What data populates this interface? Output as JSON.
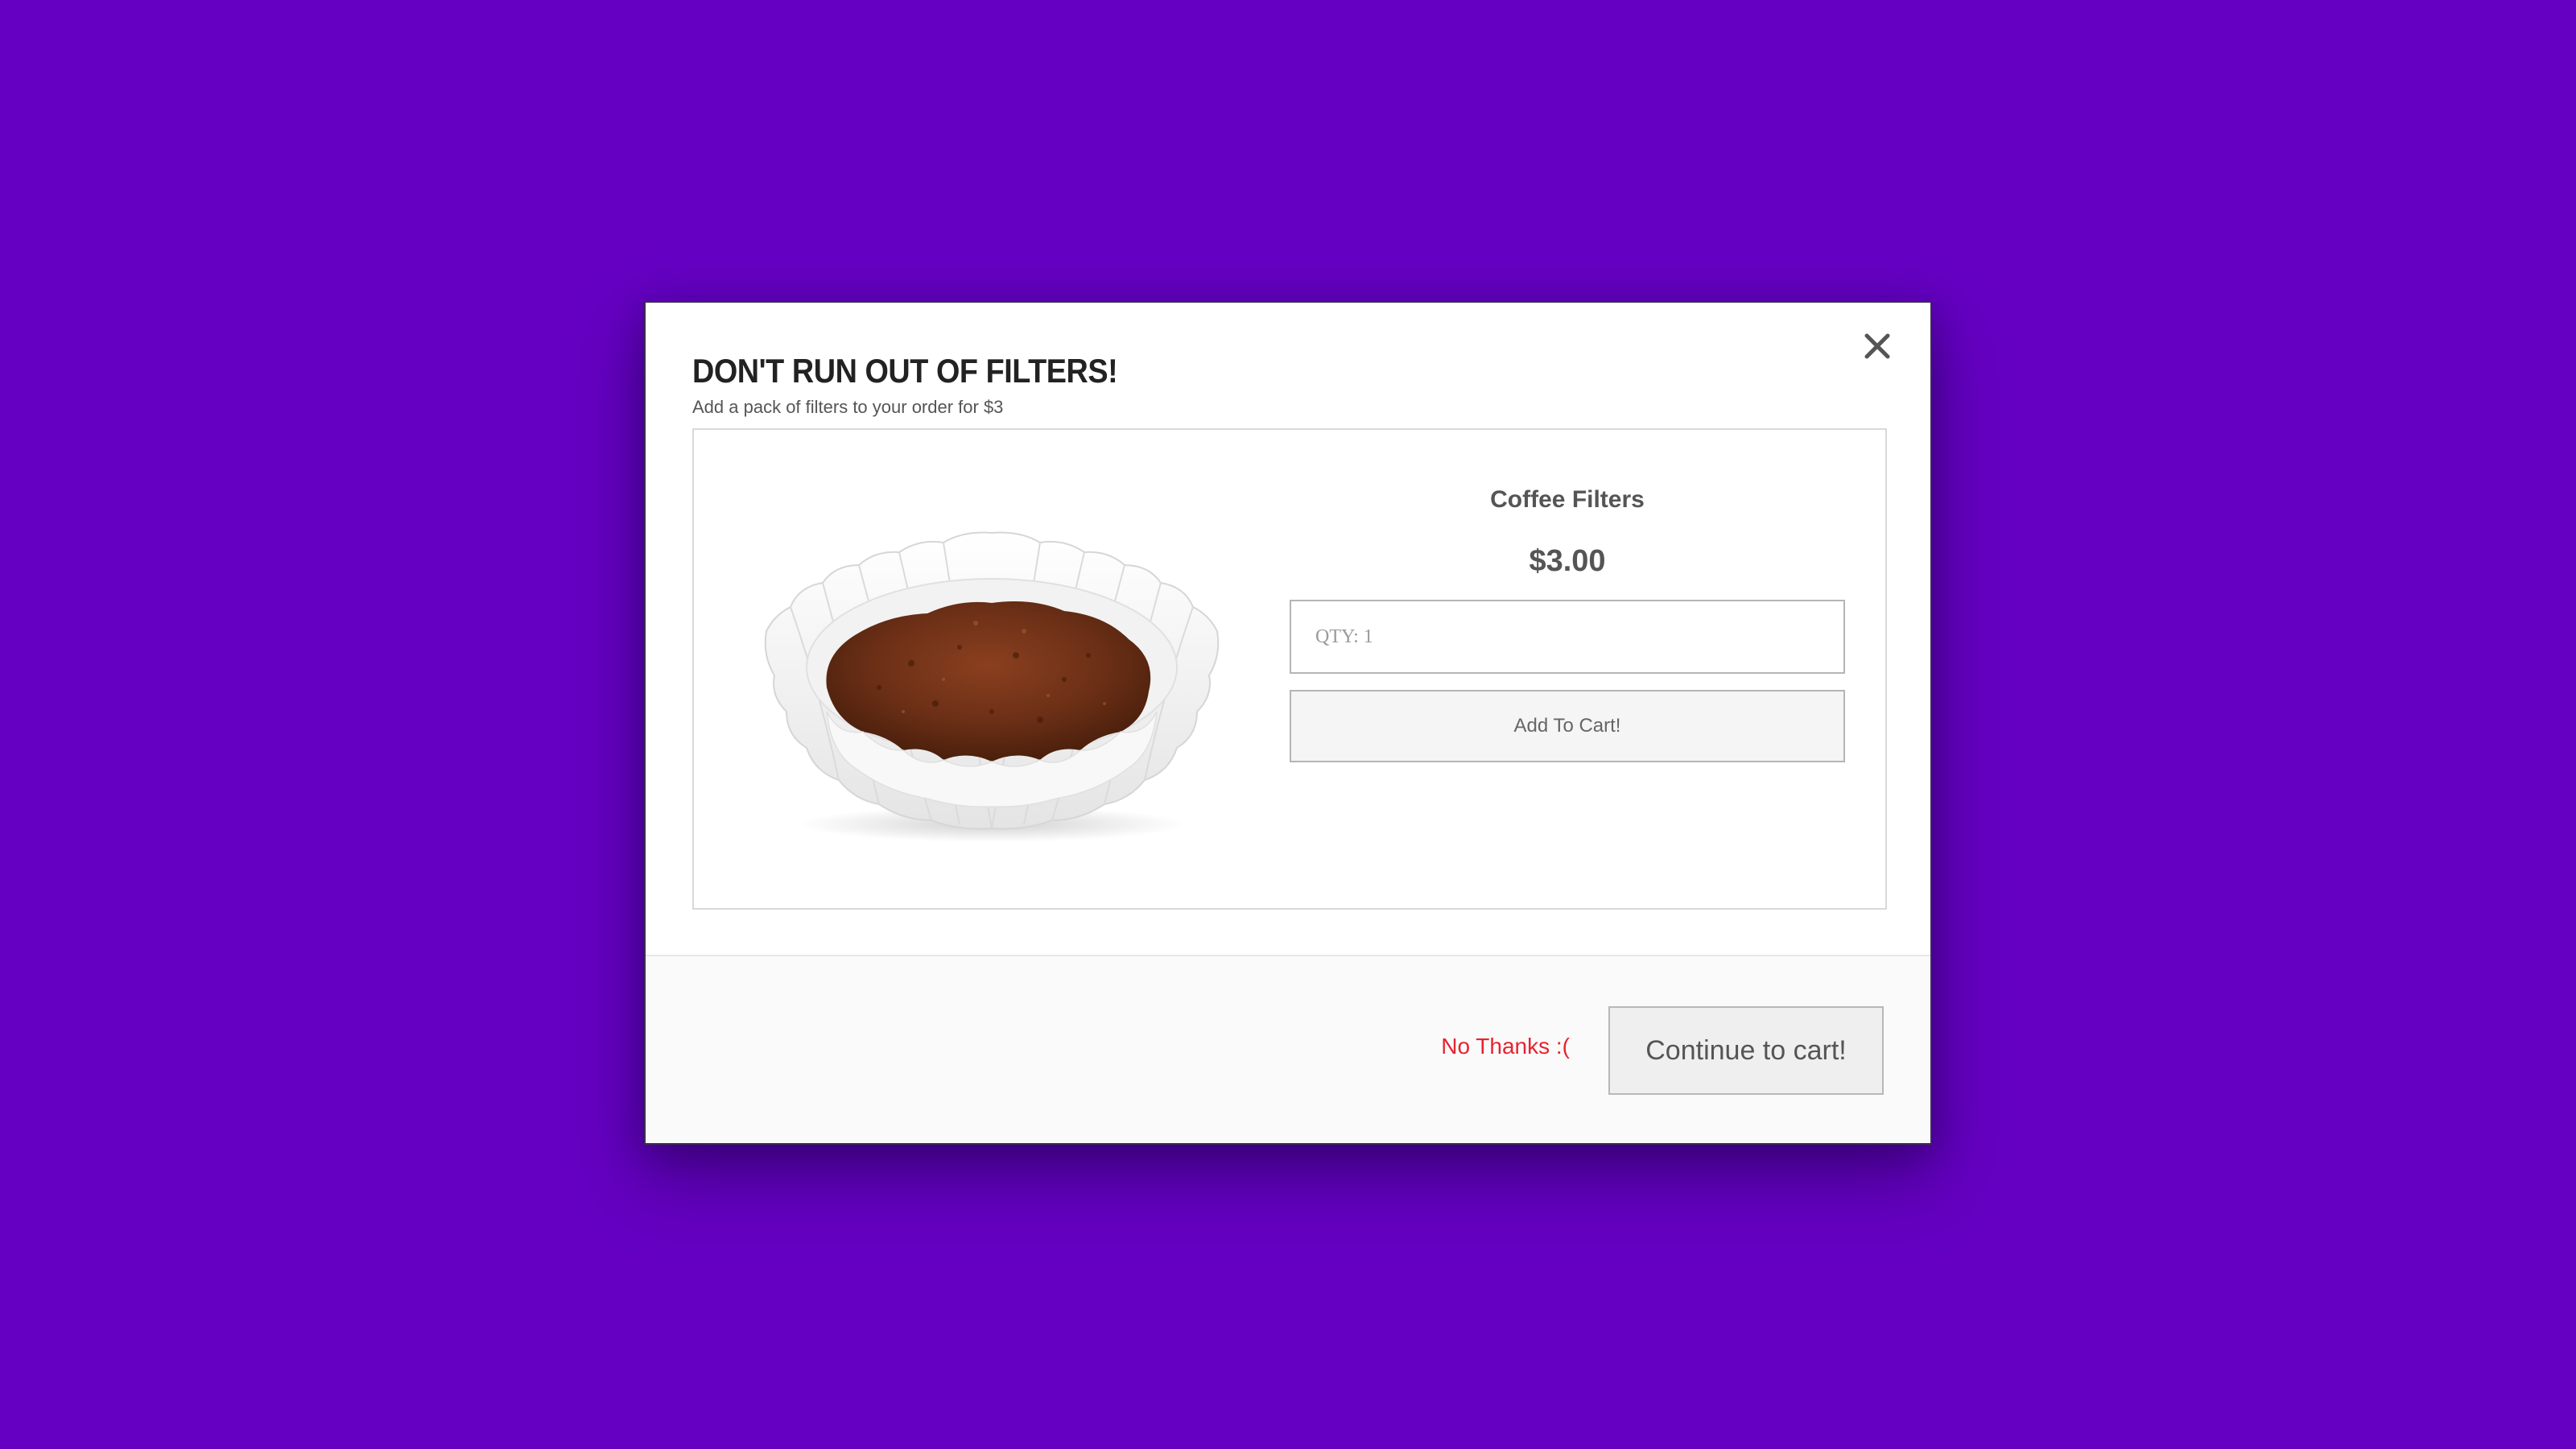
{
  "modal": {
    "title": "DON'T RUN OUT OF FILTERS!",
    "subtitle": "Add a pack of filters to your order for $3",
    "close_icon": "close-icon"
  },
  "product": {
    "image_icon": "coffee-filter-image",
    "name": "Coffee Filters",
    "price": "$3.00",
    "qty_placeholder": "QTY: 1",
    "add_to_cart_label": "Add To Cart!"
  },
  "footer": {
    "no_thanks_label": "No Thanks :(",
    "continue_label": "Continue to cart!"
  },
  "colors": {
    "background": "#6500c2",
    "no_thanks": "#e8232f",
    "coffee": "#6b2f16"
  }
}
